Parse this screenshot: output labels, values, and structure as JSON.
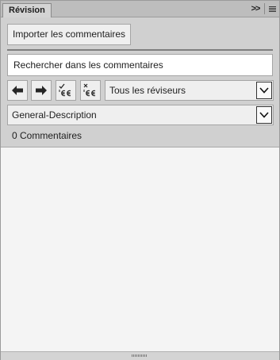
{
  "panel": {
    "tab_label": "Révision",
    "expand_icon": "double-chevron-right-icon",
    "menu_icon": "hamburger-menu-icon"
  },
  "toolbar": {
    "import_label": "Importer les commentaires",
    "search_placeholder": "Rechercher dans les commentaires",
    "reviewer_filter": "Tous les réviseurs",
    "document_select": "General-Description",
    "comment_count": "0 Commentaires"
  },
  "nav_icons": [
    "arrow-left-icon",
    "arrow-right-icon",
    "accept-comment-icon",
    "reject-comment-icon"
  ],
  "colors": {
    "panel_bg": "#d0d0d0",
    "tab_bar_bg": "#bdbdbd",
    "button_bg": "#efefef",
    "content_bg": "#f4f4f4"
  }
}
